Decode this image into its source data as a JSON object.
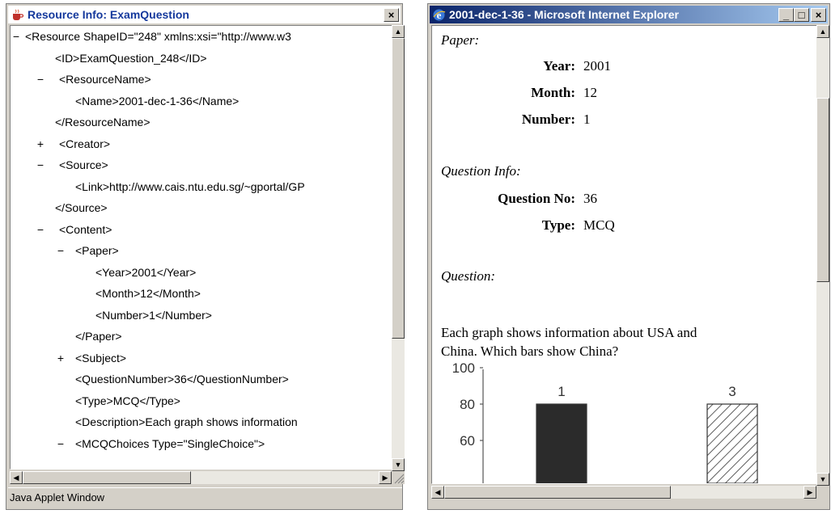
{
  "left_window": {
    "title": "Resource Info: ExamQuestion",
    "close_glyph": "×",
    "status": "Java Applet Window",
    "tree_lines": [
      {
        "toggle": "−",
        "text": "<Resource ShapeID=\"248\" xmlns:xsi=\"http://www.w3"
      },
      {
        "toggle": "",
        "text": "<ID>ExamQuestion_248</ID>"
      },
      {
        "toggle": "−",
        "text": "<ResourceName>"
      },
      {
        "toggle": "",
        "text": "<Name>2001-dec-1-36</Name>"
      },
      {
        "toggle": "",
        "text": "</ResourceName>"
      },
      {
        "toggle": "+",
        "text": "<Creator>"
      },
      {
        "toggle": "−",
        "text": "<Source>"
      },
      {
        "toggle": "",
        "text": "<Link>http://www.cais.ntu.edu.sg/~gportal/GP"
      },
      {
        "toggle": "",
        "text": "</Source>"
      },
      {
        "toggle": "−",
        "text": "<Content>"
      },
      {
        "toggle": "−",
        "text": "<Paper>"
      },
      {
        "toggle": "",
        "text": "<Year>2001</Year>"
      },
      {
        "toggle": "",
        "text": "<Month>12</Month>"
      },
      {
        "toggle": "",
        "text": "<Number>1</Number>"
      },
      {
        "toggle": "",
        "text": "</Paper>"
      },
      {
        "toggle": "+",
        "text": "<Subject>"
      },
      {
        "toggle": "",
        "text": "<QuestionNumber>36</QuestionNumber>"
      },
      {
        "toggle": "",
        "text": "<Type>MCQ</Type>"
      },
      {
        "toggle": "",
        "text": "<Description>Each graph shows information"
      },
      {
        "toggle": "−",
        "text": "<MCQChoices Type=\"SingleChoice\">"
      }
    ]
  },
  "right_window": {
    "title": "2001-dec-1-36 - Microsoft Internet Explorer",
    "min_glyph": "_",
    "max_glyph": "□",
    "close_glyph": "×",
    "paper_heading": "Paper:",
    "year_label": "Year:",
    "year_value": "2001",
    "month_label": "Month:",
    "month_value": "12",
    "number_label": "Number:",
    "number_value": "1",
    "qinfo_heading": "Question Info:",
    "qno_label": "Question No:",
    "qno_value": "36",
    "type_label": "Type:",
    "type_value": "MCQ",
    "question_heading": "Question:",
    "question_line1": "Each graph shows information about USA and",
    "question_line2": "China. Which bars show China?"
  },
  "chart_data": {
    "type": "bar",
    "categories": [
      "1",
      "3"
    ],
    "values": [
      80,
      80
    ],
    "bar_styles": [
      "solid-dark",
      "hatched"
    ],
    "yticks": [
      100,
      80,
      60
    ],
    "title": "",
    "xlabel": "",
    "ylabel": ""
  },
  "colors": {
    "titlebar_active_start": "#0a246a",
    "titlebar_active_end": "#a6caf0",
    "left_title_text": "#14389c",
    "bar_dark": "#2b2b2b"
  }
}
